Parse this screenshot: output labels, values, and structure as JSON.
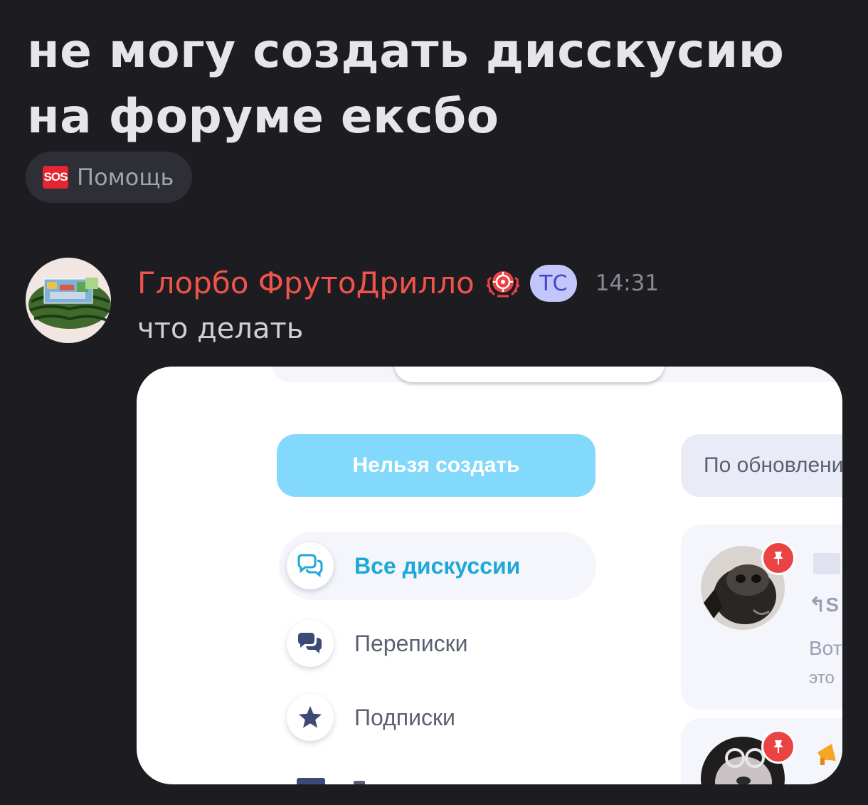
{
  "post": {
    "title": "не могу создать дисскусию на форуме ексбо",
    "tag": {
      "icon_text": "SOS",
      "label": "Помощь"
    }
  },
  "comment": {
    "author": "Глорбо ФрутоДрилло",
    "author_badge": "ТС",
    "time": "14:31",
    "text": "что делать"
  },
  "screenshot": {
    "create_button": "Нельзя создать",
    "sort_button": "По обновлени",
    "nav": [
      {
        "label": "Все дискуссии",
        "icon": "chat-bubbles-icon"
      },
      {
        "label": "Переписки",
        "icon": "chat-filled-icon"
      },
      {
        "label": "Подписки",
        "icon": "star-icon"
      }
    ],
    "card_preview_lines": [
      "Вот",
      "это"
    ],
    "card_reply_prefix": "S"
  },
  "colors": {
    "background": "#1c1c21",
    "author_name": "#f0534c",
    "badge_bg": "#c2c6fb",
    "badge_text": "#3f47c6",
    "create_button": "#82d9fb",
    "active_nav": "#1ea8d8",
    "sos_red": "#e52531",
    "pin_red": "#e94344"
  }
}
